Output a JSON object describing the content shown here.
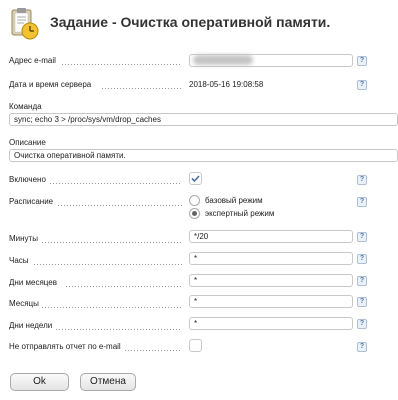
{
  "header": {
    "title": "Задание - Очистка оперативной памяти."
  },
  "fields": {
    "email_label": "Адрес e-mail",
    "datetime_label": "Дата и время сервера",
    "datetime_value": "2018-05-16 19:08:58",
    "command_label": "Команда",
    "command_value": "sync; echo 3 > /proc/sys/vm/drop_caches",
    "description_label": "Описание",
    "description_value": "Очистка оперативной памяти.",
    "enabled_label": "Включено",
    "schedule_label": "Расписание",
    "schedule_basic": "базовый режим",
    "schedule_expert": "экспертный режим",
    "minutes_label": "Минуты",
    "minutes_value": "*/20",
    "hours_label": "Часы",
    "hours_value": "*",
    "days_label": "Дни месяцев",
    "days_value": "*",
    "months_label": "Месяцы",
    "months_value": "*",
    "weekdays_label": "Дни недели",
    "weekdays_value": "*",
    "noreport_label": "Не отправлять отчет по e-mail"
  },
  "state": {
    "enabled": true,
    "schedule_mode": "expert",
    "no_report": false
  },
  "help": "?",
  "buttons": {
    "ok": "Ok",
    "cancel": "Отмена"
  }
}
